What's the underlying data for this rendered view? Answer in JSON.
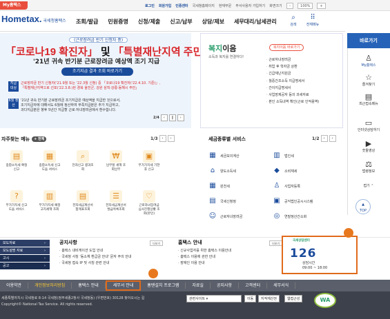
{
  "topbar": {
    "my_tab": "My홈택스",
    "links": [
      "로그인",
      "회원가입",
      "인증센터",
      "국세청홈페이지",
      "현재부문",
      "부서사용자 가입하기",
      "화면크기"
    ],
    "zoom": "100%"
  },
  "header": {
    "logo": "Hometax.",
    "logo_sub": "국세청홈택스",
    "menu": [
      "조회/발급",
      "민원증명",
      "신청/제출",
      "신고/납부",
      "상담/제보",
      "세무대리/납세관리"
    ],
    "search": "검색",
    "all_menu": "전체메뉴"
  },
  "banner": {
    "subtitle": "(근로장려금 반기 신청자 중)",
    "title_a": "「코로나19 확진자」",
    "title_and": "및",
    "title_b": "「특별재난지역 주민」",
    "line2": "'21년 귀속 반기분 근로장려금 예상액 조기 지급",
    "button": "조기지급 결과 조회 바로가기",
    "notice1_tag": "지급 대상",
    "notice1_line1": "근로장려금 반기 신청자('21.9월 또는 '22.3월 신청) 중 「코로나19 확진자('22.4.10. 기준)」,",
    "notice1_line2": "「특별재난지역으로 선포('22.3.8.)된 경북 울진군, 강원 삼척·강릉·동해시 주민」",
    "notice2_tag": "6월 정산",
    "notice2_line1": "'21년 귀속 반기분 근로장려금 조기지급은 예상액을 지급한 것으로서,",
    "notice2_line2": "조기지급자에 대해서도 6월에 정산하여 부족지급분은 추가 지급하고,",
    "notice2_line3": "과다지급분은 향후 5년간 지급할 근로·자녀장려금에서 환수합니다.",
    "pager": "2/4"
  },
  "welfare": {
    "title_a": "복지",
    "title_b": "이음",
    "desc": "소득과 복지를 연결하다!",
    "pill": "복지이음 바로가기",
    "items": [
      "근로자녀장려금",
      "취업 후 학자금 상환",
      "긴급재난지원금",
      "월중간조소득 지급명세서",
      "간이지급명세서",
      "사업장제공자 등의 과세자료",
      "본인 소득내역 확인(근로 인적용역)"
    ]
  },
  "sidebar": {
    "head": "바로가기",
    "items": [
      "My홈택스",
      "즐겨찾기",
      "최근접속메뉴",
      "인터넷상담하기",
      "숫돌영상",
      "법령정보",
      "접기"
    ],
    "top": "TOP"
  },
  "freq_menu": {
    "title": "자주찾는 메뉴",
    "plus": "+ 전체",
    "pager": "1/3",
    "items": [
      "종합소득세 확정신고",
      "종합소득세 신고도움 서비스",
      "전자신고 결과조회",
      "납부할 세액 조회납부",
      "부가가치세 기한후 신고",
      "부가가치세 신고도움 서비스",
      "부가가치세 예정고지세액 조회",
      "전자세금계산서 합계표조회",
      "전자세금계산서 발급목록조회",
      "근로자녀장려금 심사진행상황 조회(본인)"
    ]
  },
  "tax_service": {
    "title": "세금종류별 서비스",
    "pager": "1/2",
    "items": [
      "세금모의계산",
      "법인세",
      "양도소득세",
      "소비재세",
      "원천세",
      "사업자등록",
      "국세신청정",
      "공익법인공시시스템",
      "근로자녀장려금",
      "연말정산간소화"
    ]
  },
  "quick_links": [
    "보도자료",
    "보도설명 자료",
    "고시",
    "공고"
  ],
  "notices": {
    "title": "공지사항",
    "more": "더보기",
    "items": [
      "홈택스 내비게이션 도입 안내",
      "국세청 사칭 '동소체 환급금 안내' 문자 주의 안내",
      "국세청 접속 IP 및 사칭 관련 안내"
    ]
  },
  "hometax_notice": {
    "title": "홈택스 안내",
    "more": "더보기",
    "items": [
      "신규사업자를 위한 홈택스 이용안내",
      "홈택스 이용에 관한 안내",
      "장애인 이용 안내"
    ]
  },
  "call": {
    "tag": "국세상담센터",
    "number": "126",
    "hours_label": "상담시간",
    "hours": "09:00 ~ 18:00"
  },
  "footer": {
    "nav": [
      "이용약관",
      "개인정보처리방침",
      "홈택스 안내",
      "세무서 안내",
      "홈텐설치 프로그램",
      "자료실",
      "공지사항",
      "고객센터",
      "세무서식"
    ],
    "address": "세종특별자치시 국세청로 8-14 국세청(정부세종2청사 국세청동) (우편번호) 30128  찾아오시는 길",
    "copyright": "Copyright© National Tax Service. All rights reserved.",
    "related": "관련사이트",
    "go": "이동",
    "badge1": "지적재산권",
    "badge2": "웹접근성",
    "wa": "WA"
  }
}
